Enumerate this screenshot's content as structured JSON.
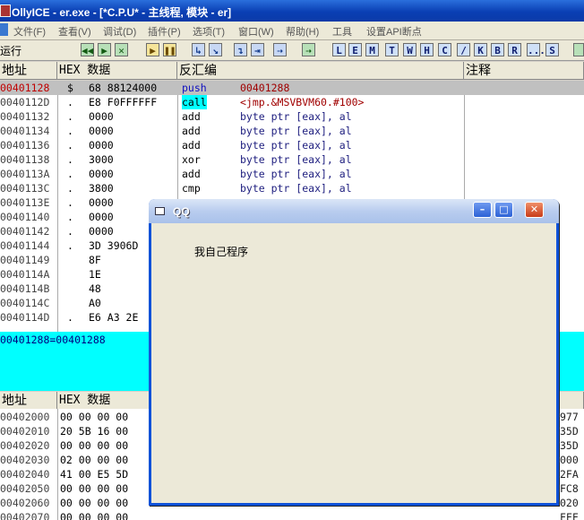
{
  "window": {
    "title": "OllyICE - er.exe - [*C.P.U* - 主线程, 模块 - er]"
  },
  "menu": [
    "文件(F)",
    "查看(V)",
    "调试(D)",
    "插件(P)",
    "选项(T)",
    "窗口(W)",
    "帮助(H)",
    "工具",
    "设置API断点"
  ],
  "toolbar": {
    "status": "运行",
    "buttons": [
      "◀◀",
      "▶",
      "✕",
      "▶",
      "❚❚",
      "↳",
      "↘",
      "↴",
      "⇥",
      "⇢",
      "L",
      "E",
      "M",
      "T",
      "W",
      "H",
      "C",
      "/",
      "K",
      "B",
      "R",
      "...",
      "S"
    ]
  },
  "cpu": {
    "headers": {
      "addr": "地址",
      "hex": "HEX 数据",
      "disasm": "反汇编",
      "comment": "注释"
    },
    "rows": [
      {
        "addr": "00401128",
        "mark": "$",
        "hex": "68 88124000",
        "mn": "push",
        "op": "00401288"
      },
      {
        "addr": "0040112D",
        "mark": ".",
        "hex": "E8 F0FFFFFF",
        "mn": "call",
        "op": "<jmp.&MSVBVM60.#100>"
      },
      {
        "addr": "00401132",
        "mark": ".",
        "hex": "0000",
        "mn": "add",
        "op": "byte ptr [eax], al"
      },
      {
        "addr": "00401134",
        "mark": ".",
        "hex": "0000",
        "mn": "add",
        "op": "byte ptr [eax], al"
      },
      {
        "addr": "00401136",
        "mark": ".",
        "hex": "0000",
        "mn": "add",
        "op": "byte ptr [eax], al"
      },
      {
        "addr": "00401138",
        "mark": ".",
        "hex": "3000",
        "mn": "xor",
        "op": "byte ptr [eax], al"
      },
      {
        "addr": "0040113A",
        "mark": ".",
        "hex": "0000",
        "mn": "add",
        "op": "byte ptr [eax], al"
      },
      {
        "addr": "0040113C",
        "mark": ".",
        "hex": "3800",
        "mn": "cmp",
        "op": "byte ptr [eax], al"
      },
      {
        "addr": "0040113E",
        "mark": ".",
        "hex": "0000",
        "mn": "",
        "op": ""
      },
      {
        "addr": "00401140",
        "mark": ".",
        "hex": "0000",
        "mn": "",
        "op": ""
      },
      {
        "addr": "00401142",
        "mark": ".",
        "hex": "0000",
        "mn": "",
        "op": ""
      },
      {
        "addr": "00401144",
        "mark": ".",
        "hex": "3D 3906D",
        "mn": "",
        "op": ""
      },
      {
        "addr": "00401149",
        "mark": "",
        "hex": "8F",
        "mn": "",
        "op": ""
      },
      {
        "addr": "0040114A",
        "mark": "",
        "hex": "1E",
        "mn": "",
        "op": ""
      },
      {
        "addr": "0040114B",
        "mark": "",
        "hex": "48",
        "mn": "",
        "op": ""
      },
      {
        "addr": "0040114C",
        "mark": "",
        "hex": "A0",
        "mn": "",
        "op": ""
      },
      {
        "addr": "0040114D",
        "mark": ".",
        "hex": "E6 A3 2E",
        "mn": "",
        "op": ""
      }
    ]
  },
  "info": {
    "text": "00401288=00401288"
  },
  "dump": {
    "headers": {
      "addr": "地址",
      "hex": "HEX 数据"
    },
    "rows": [
      {
        "addr": "00402000",
        "hex": "00 00 00 00",
        "stack": "977"
      },
      {
        "addr": "00402010",
        "hex": "20 5B 16 00",
        "stack": "35D"
      },
      {
        "addr": "00402020",
        "hex": "00 00 00 00",
        "stack": "35D"
      },
      {
        "addr": "00402030",
        "hex": "02 00 00 00",
        "stack": "000"
      },
      {
        "addr": "00402040",
        "hex": "41 00 E5 5D",
        "stack": "2FA"
      },
      {
        "addr": "00402050",
        "hex": "00 00 00 00",
        "stack": "FC8"
      },
      {
        "addr": "00402060",
        "hex": "00 00 00 00",
        "stack": "020"
      },
      {
        "addr": "00402070",
        "hex": "00 00 00 00",
        "stack": "FFF"
      }
    ]
  },
  "dialog": {
    "title": "QQ",
    "label": "我自己程序",
    "btn_min": "–",
    "btn_max": "□",
    "btn_close": "✕"
  }
}
